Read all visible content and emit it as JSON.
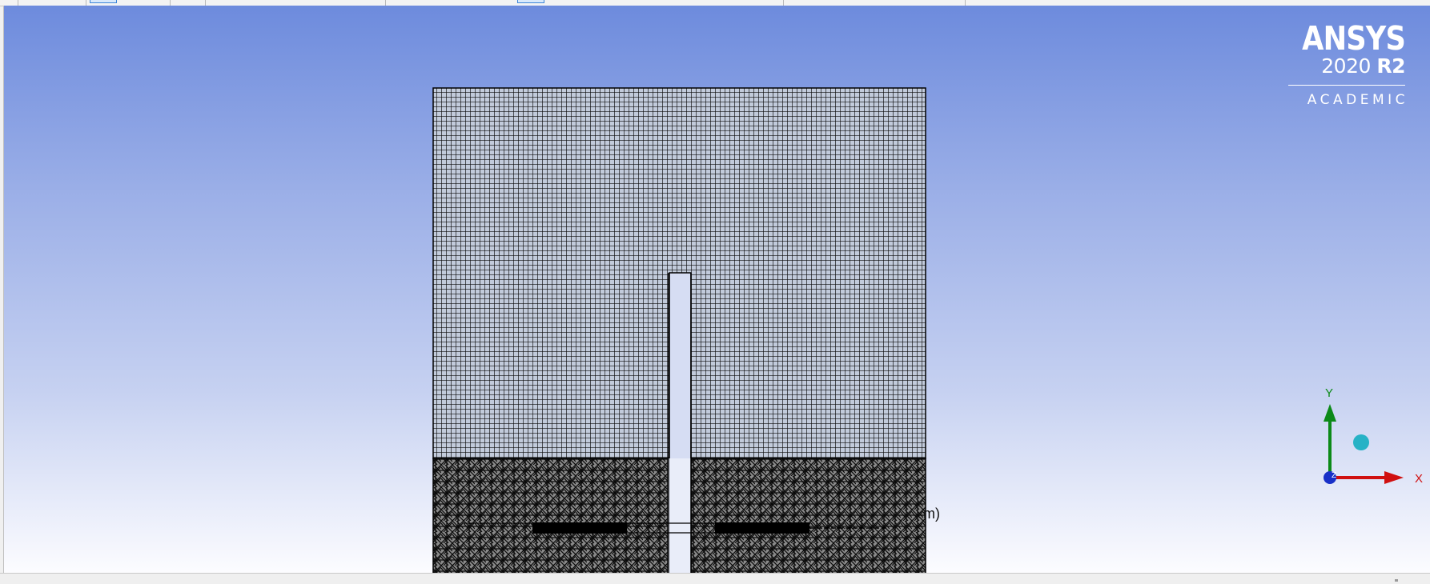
{
  "logo": {
    "brand": "ANSYS",
    "version_year": "2020",
    "version_release": "R2",
    "edition": "ACADEMIC"
  },
  "triad": {
    "x_label": "X",
    "y_label": "Y",
    "z_label": "Z",
    "x_color": "#d01010",
    "y_color": "#0c8a18",
    "z_color": "#1830c8",
    "iso_sphere_color": "#27b2c6"
  },
  "scale_bar": {
    "unit_fragment": "m)"
  },
  "mesh": {
    "edge_color": "#0b0b0b",
    "face_color": "#b8c3d8"
  }
}
